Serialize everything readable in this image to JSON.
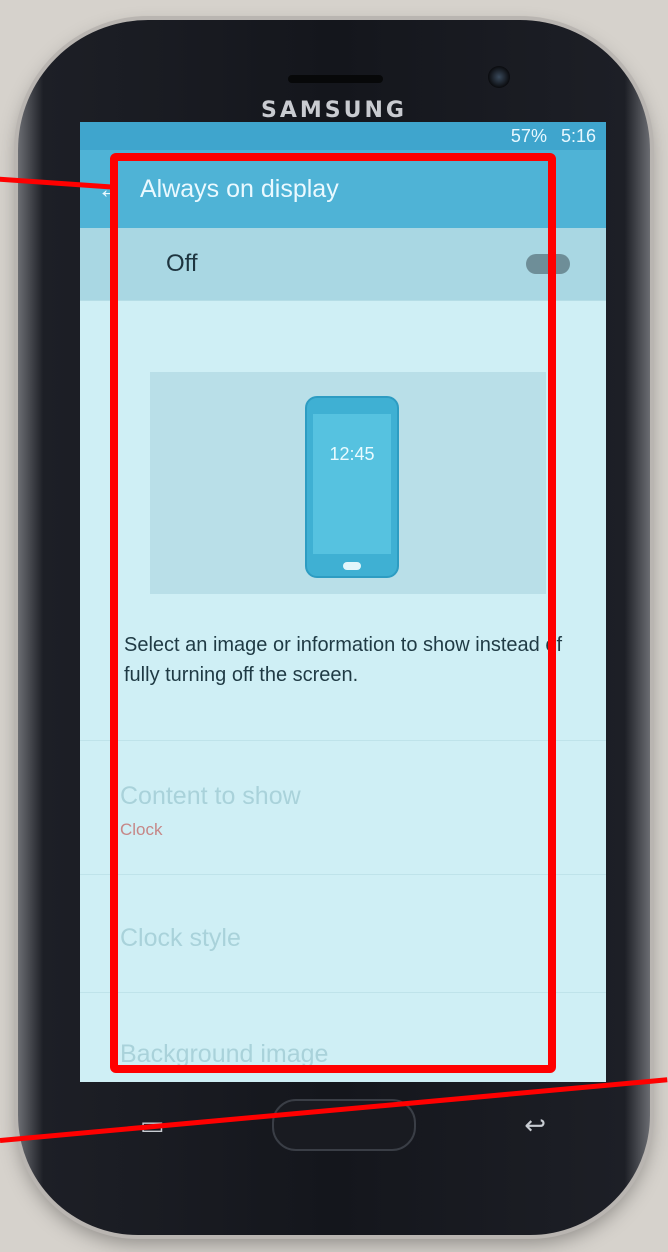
{
  "device": {
    "brand": "SAMSUNG"
  },
  "status_bar": {
    "time": "5:16",
    "battery": "57%"
  },
  "app_bar": {
    "title": "Always on display",
    "back_icon": "arrow-left-icon"
  },
  "master_switch": {
    "label": "Off",
    "state": "off"
  },
  "preview": {
    "clock": "12:45"
  },
  "description": "Select an image or information to show instead of fully turning off the screen.",
  "items": [
    {
      "title": "Content to show",
      "subtitle": "Clock"
    },
    {
      "title": "Clock style"
    },
    {
      "title": "Background image"
    }
  ],
  "colors": {
    "app_bar": "#4fb3d6",
    "status_bar": "#3fa5cd",
    "annotation": "#ff0000"
  }
}
